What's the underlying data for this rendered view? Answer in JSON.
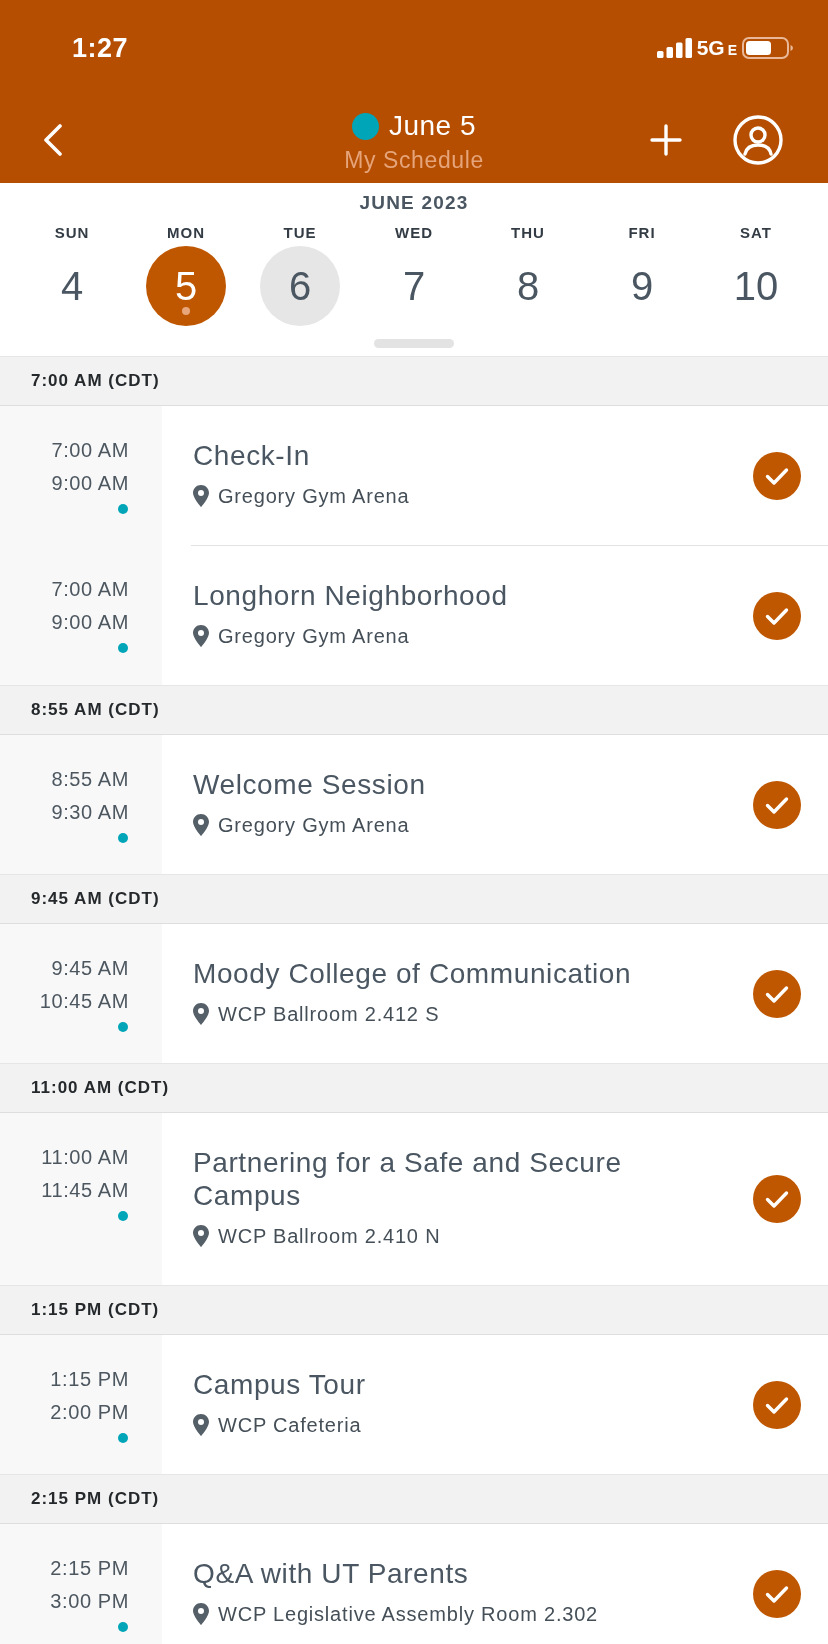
{
  "status_bar": {
    "time": "1:27",
    "network": "5G",
    "network_suffix": "E"
  },
  "nav": {
    "title": "June 5",
    "subtitle": "My Schedule"
  },
  "calendar": {
    "month": "JUNE 2023",
    "days": [
      {
        "weekday": "SUN",
        "date": "4",
        "selected": false,
        "today": false,
        "has_events": false
      },
      {
        "weekday": "MON",
        "date": "5",
        "selected": true,
        "today": false,
        "has_events": true
      },
      {
        "weekday": "TUE",
        "date": "6",
        "selected": false,
        "today": true,
        "has_events": false
      },
      {
        "weekday": "WED",
        "date": "7",
        "selected": false,
        "today": false,
        "has_events": false
      },
      {
        "weekday": "THU",
        "date": "8",
        "selected": false,
        "today": false,
        "has_events": false
      },
      {
        "weekday": "FRI",
        "date": "9",
        "selected": false,
        "today": false,
        "has_events": false
      },
      {
        "weekday": "SAT",
        "date": "10",
        "selected": false,
        "today": false,
        "has_events": false
      }
    ]
  },
  "sections": [
    {
      "heading": "7:00 AM (CDT)",
      "events": [
        {
          "start": "7:00 AM",
          "end": "9:00 AM",
          "title": "Check-In",
          "location": "Gregory Gym Arena",
          "added": true
        },
        {
          "start": "7:00 AM",
          "end": "9:00 AM",
          "title": "Longhorn Neighborhood",
          "location": "Gregory Gym Arena",
          "added": true
        }
      ]
    },
    {
      "heading": "8:55 AM (CDT)",
      "events": [
        {
          "start": "8:55 AM",
          "end": "9:30 AM",
          "title": "Welcome Session",
          "location": "Gregory Gym Arena",
          "added": true
        }
      ]
    },
    {
      "heading": "9:45 AM (CDT)",
      "events": [
        {
          "start": "9:45 AM",
          "end": "10:45 AM",
          "title": "Moody College of Communication",
          "location": "WCP Ballroom 2.412 S",
          "added": true
        }
      ]
    },
    {
      "heading": "11:00 AM (CDT)",
      "events": [
        {
          "start": "11:00 AM",
          "end": "11:45 AM",
          "title": "Partnering for a Safe and Secure Campus",
          "location": "WCP Ballroom 2.410 N",
          "added": true
        }
      ]
    },
    {
      "heading": "1:15 PM (CDT)",
      "events": [
        {
          "start": "1:15 PM",
          "end": "2:00 PM",
          "title": "Campus Tour",
          "location": "WCP Cafeteria",
          "added": true
        }
      ]
    },
    {
      "heading": "2:15 PM (CDT)",
      "events": [
        {
          "start": "2:15 PM",
          "end": "3:00 PM",
          "title": "Q&A with UT Parents",
          "location": "WCP Legislative Assembly Room 2.302",
          "added": true
        }
      ]
    }
  ]
}
